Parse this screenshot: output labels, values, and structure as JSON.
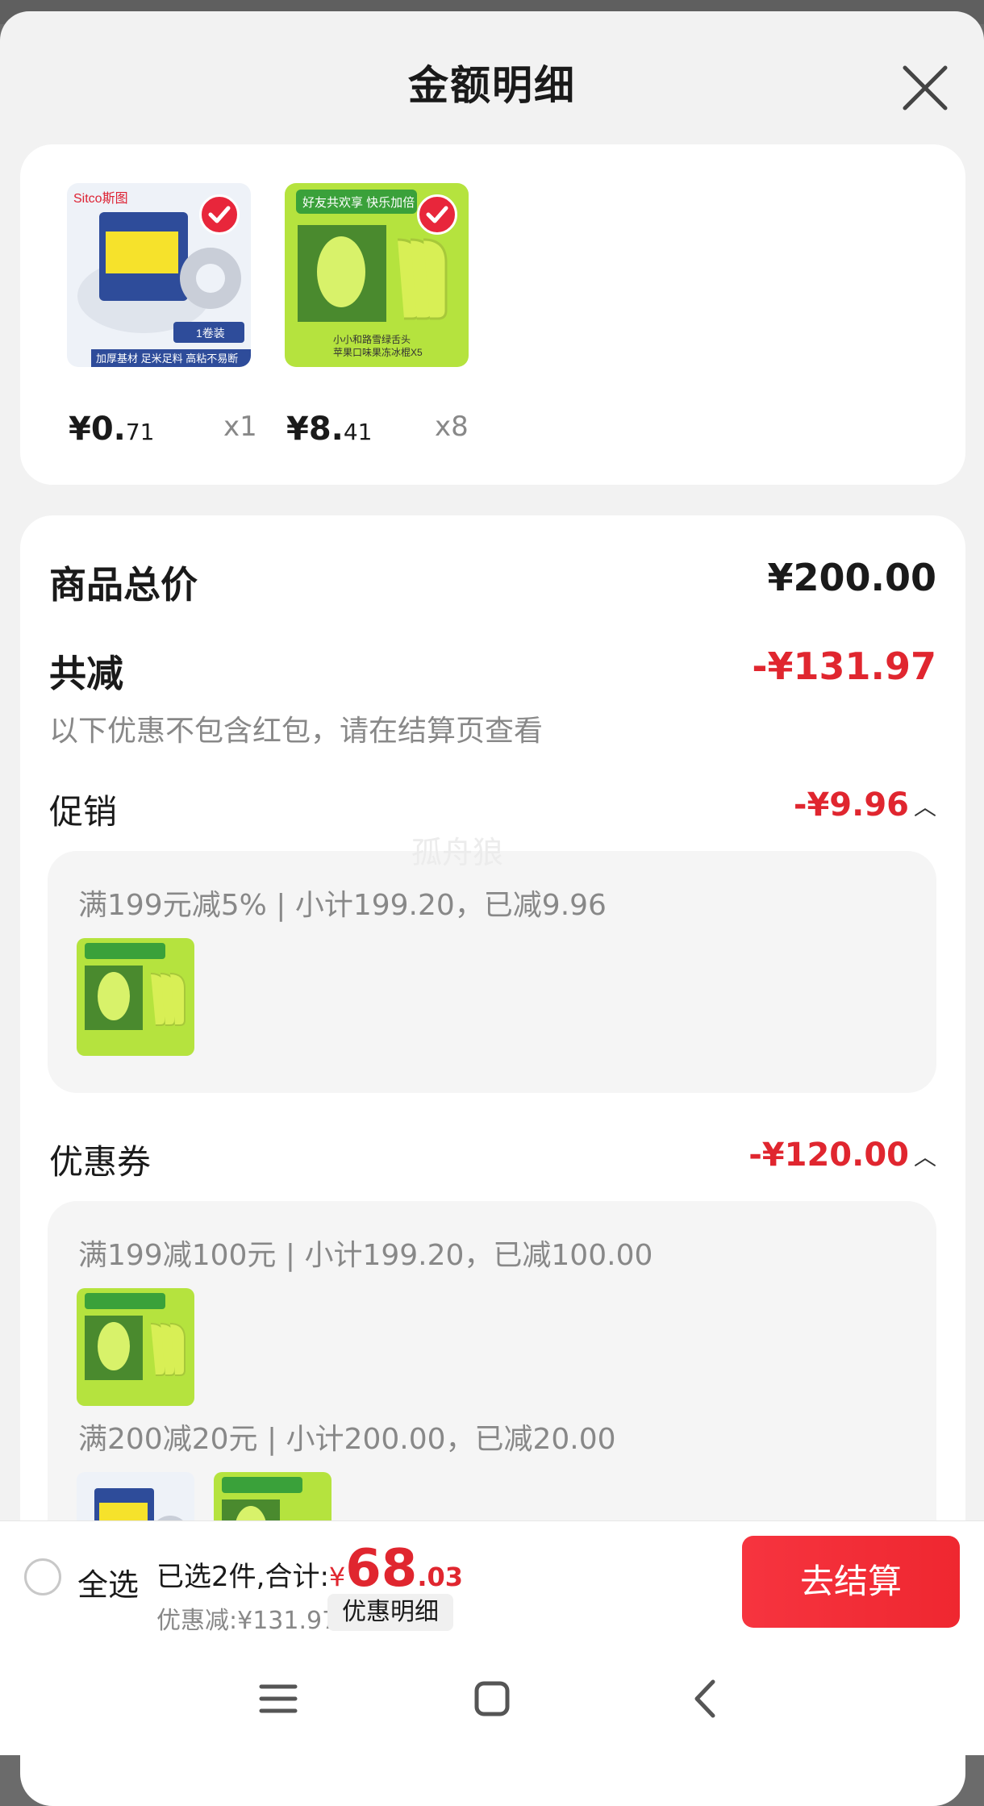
{
  "header": {
    "title": "金额明细"
  },
  "products": [
    {
      "price_int": "¥0.",
      "price_dec": "71",
      "qty": "x1",
      "brand": "Sitco斯图",
      "tag": "加厚基材 足米足料 高粘不易断",
      "pack": "1卷装"
    },
    {
      "price_int": "¥8.",
      "price_dec": "41",
      "qty": "x8",
      "banner": "好友共欢享 快乐加倍",
      "caption1": "小小和路雪绿舌头",
      "caption2": "苹果口味果冻冰棍X5"
    }
  ],
  "summary": {
    "total_label": "商品总价",
    "total_value": "¥200.00",
    "reduce_label": "共减",
    "reduce_value": "-¥131.97",
    "note": "以下优惠不包含红包，请在结算页查看"
  },
  "promo": {
    "label": "促销",
    "value": "-¥9.96",
    "rule": "满199元减5% | 小计199.20，已减9.96"
  },
  "coupon": {
    "label": "优惠券",
    "value": "-¥120.00",
    "rule1": "满199减100元 | 小计199.20，已减100.00",
    "rule2": "满200减20元 | 小计200.00，已减20.00"
  },
  "watermark": "孤舟狼",
  "bottom": {
    "select_all": "全选",
    "selected_prefix": "已选2件,合计:",
    "currency": "¥",
    "amount_int": "68",
    "amount_dec": ".03",
    "discount": "优惠减:¥131.97",
    "detail_button": "优惠明细",
    "checkout_button": "去结算"
  },
  "colors": {
    "accent_red": "#e0262f",
    "checkout_red": "#f6343f",
    "icecream_green": "#b5e33e"
  }
}
